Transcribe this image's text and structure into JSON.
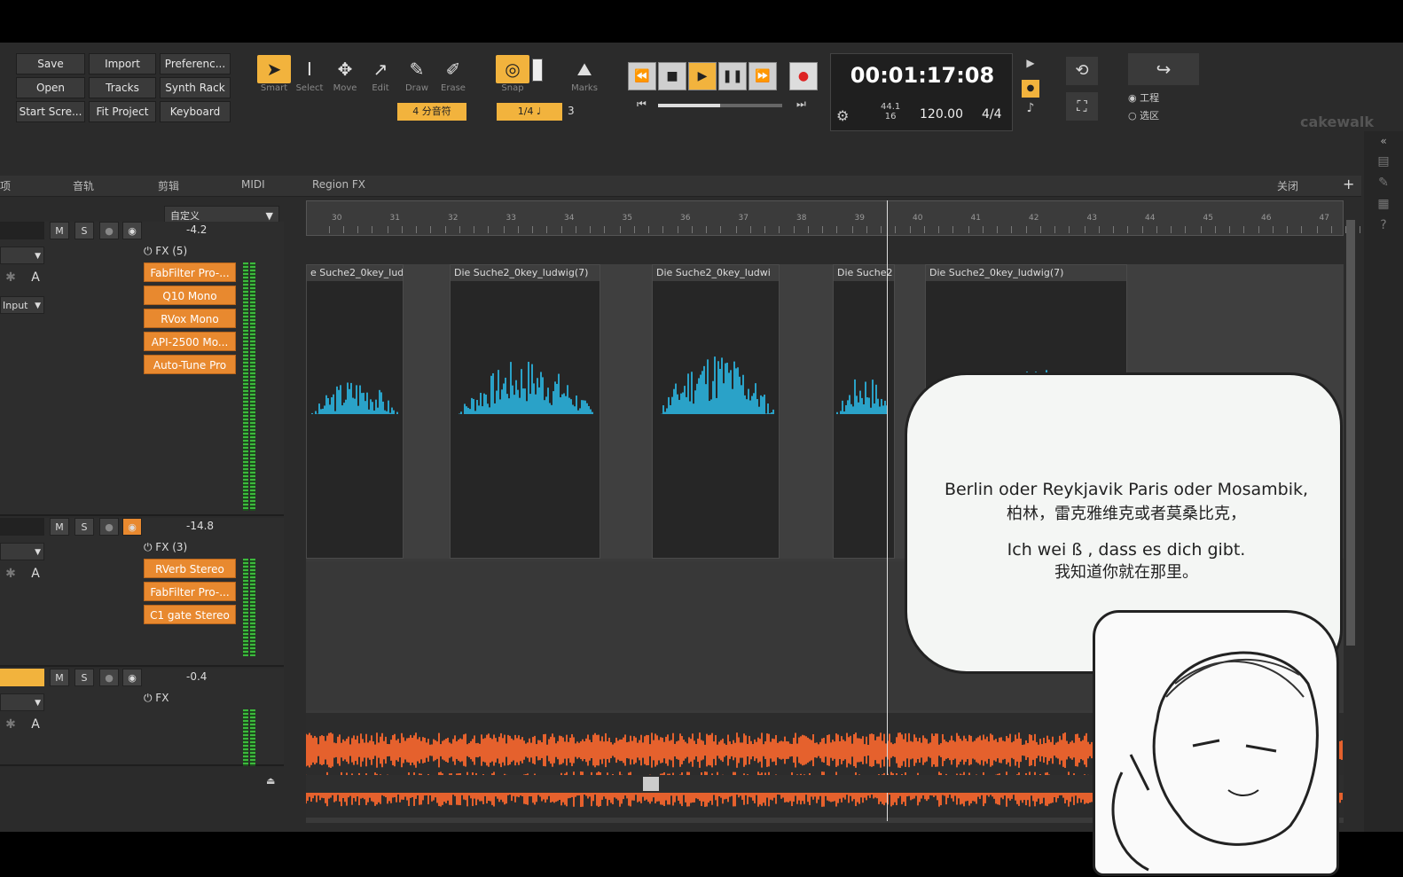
{
  "file_menu": {
    "save": "Save",
    "import": "Import",
    "preferences": "Preferenc...",
    "open": "Open",
    "tracks": "Tracks",
    "synth_rack": "Synth Rack",
    "start_screen": "Start Scre...",
    "fit_project": "Fit Project",
    "keyboard": "Keyboard"
  },
  "tools": {
    "smart": "Smart",
    "select": "Select",
    "move": "Move",
    "edit": "Edit",
    "draw": "Draw",
    "erase": "Erase",
    "snap": "Snap",
    "marks": "Marks",
    "note_value": "4 分音符",
    "snap_value": "1/4",
    "snap_extra": "3"
  },
  "transport": {
    "time": "00:01:17:08",
    "sample_rate_top": "44.1",
    "sample_rate_bottom": "16",
    "tempo": "120.00",
    "meter": "4/4"
  },
  "view_options": {
    "project": "工程",
    "region": "选区"
  },
  "logo": "cakewalk",
  "menubar": {
    "m0": "项",
    "m1": "音轨",
    "m2": "剪辑",
    "m3": "MIDI",
    "m4": "Region FX",
    "m5": "关闭"
  },
  "custom_dropdown": "自定义",
  "ruler_ticks": [
    "30",
    "31",
    "32",
    "33",
    "34",
    "35",
    "36",
    "37",
    "38",
    "39",
    "40",
    "41",
    "42",
    "43",
    "44",
    "45",
    "46",
    "47"
  ],
  "tracks": [
    {
      "volume": "-4.2",
      "fx_header": "FX (5)",
      "fx": [
        "FabFilter Pro-...",
        "Q10 Mono",
        "RVox Mono",
        "API-2500 Mo...",
        "Auto-Tune Pro"
      ],
      "input": "Input",
      "m": "M",
      "s": "S",
      "a": "A"
    },
    {
      "volume": "-14.8",
      "fx_header": "FX (3)",
      "fx": [
        "RVerb Stereo",
        "FabFilter Pro-...",
        "C1 gate Stereo"
      ],
      "m": "M",
      "s": "S",
      "a": "A"
    },
    {
      "volume": "-0.4",
      "fx_header": "FX",
      "fx": [],
      "m": "M",
      "s": "S",
      "a": "A"
    }
  ],
  "clips": [
    "e Suche2_0key_lud",
    "Die Suche2_0key_ludwig(7)",
    "Die Suche2_0key_ludwi",
    "Die Suche2",
    "Die Suche2_0key_ludwig(7)"
  ],
  "subtitle": {
    "line1": "Berlin oder Reykjavik Paris oder Mosambik,",
    "line2": "柏林，雷克雅维克或者莫桑比克，",
    "line3": "Ich wei ß , dass es dich gibt.",
    "line4": "我知道你就在那里。"
  },
  "colors": {
    "accent": "#f2b33d",
    "vocal_wave": "#2aa2c8",
    "orange_wave": "#e5612d",
    "fx_bg": "#e8892f"
  }
}
